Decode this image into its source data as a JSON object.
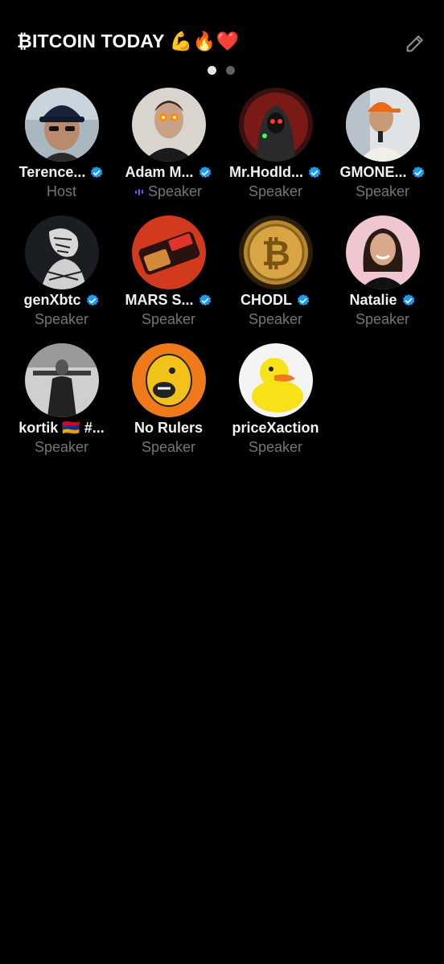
{
  "space": {
    "title": "₿ITCOIN TODAY 💪🔥❤️"
  },
  "pager": {
    "pages": 2,
    "active": 0
  },
  "participants": [
    {
      "name": "Terence...",
      "role": "Host",
      "verified": true,
      "avatar": "woman-sunglasses-cap-avatar"
    },
    {
      "name": "Adam M...",
      "role": "Speaker",
      "verified": true,
      "speaking": true,
      "avatar": "man-laser-eyes-avatar"
    },
    {
      "name": "Mr.Hodld...",
      "role": "Speaker",
      "verified": true,
      "avatar": "hooded-figure-red-avatar"
    },
    {
      "name": "GMONE...",
      "role": "Speaker",
      "verified": true,
      "avatar": "man-orange-cap-avatar"
    },
    {
      "name": "genXbtc",
      "role": "Speaker",
      "verified": true,
      "avatar": "bw-sketch-avatar"
    },
    {
      "name": "MARS S...",
      "role": "Speaker",
      "verified": true,
      "avatar": "candy-bar-avatar"
    },
    {
      "name": "CHODL",
      "role": "Speaker",
      "verified": true,
      "avatar": "bitcoin-coin-avatar"
    },
    {
      "name": "Natalie",
      "role": "Speaker",
      "verified": true,
      "avatar": "woman-smiling-avatar"
    },
    {
      "name": "kortik 🇦🇲 #...",
      "role": "Speaker",
      "verified": false,
      "avatar": "martial-artist-avatar"
    },
    {
      "name": "No Rulers",
      "role": "Speaker",
      "verified": false,
      "avatar": "cartoon-dog-avatar"
    },
    {
      "name": "priceXaction",
      "role": "Speaker",
      "verified": false,
      "avatar": "rubber-duck-avatar"
    }
  ],
  "colors": {
    "background": "#000000",
    "name": "#f1f2f3",
    "role": "#71767b",
    "verified": "#1d9bf0",
    "speaking": "#7856ff"
  }
}
